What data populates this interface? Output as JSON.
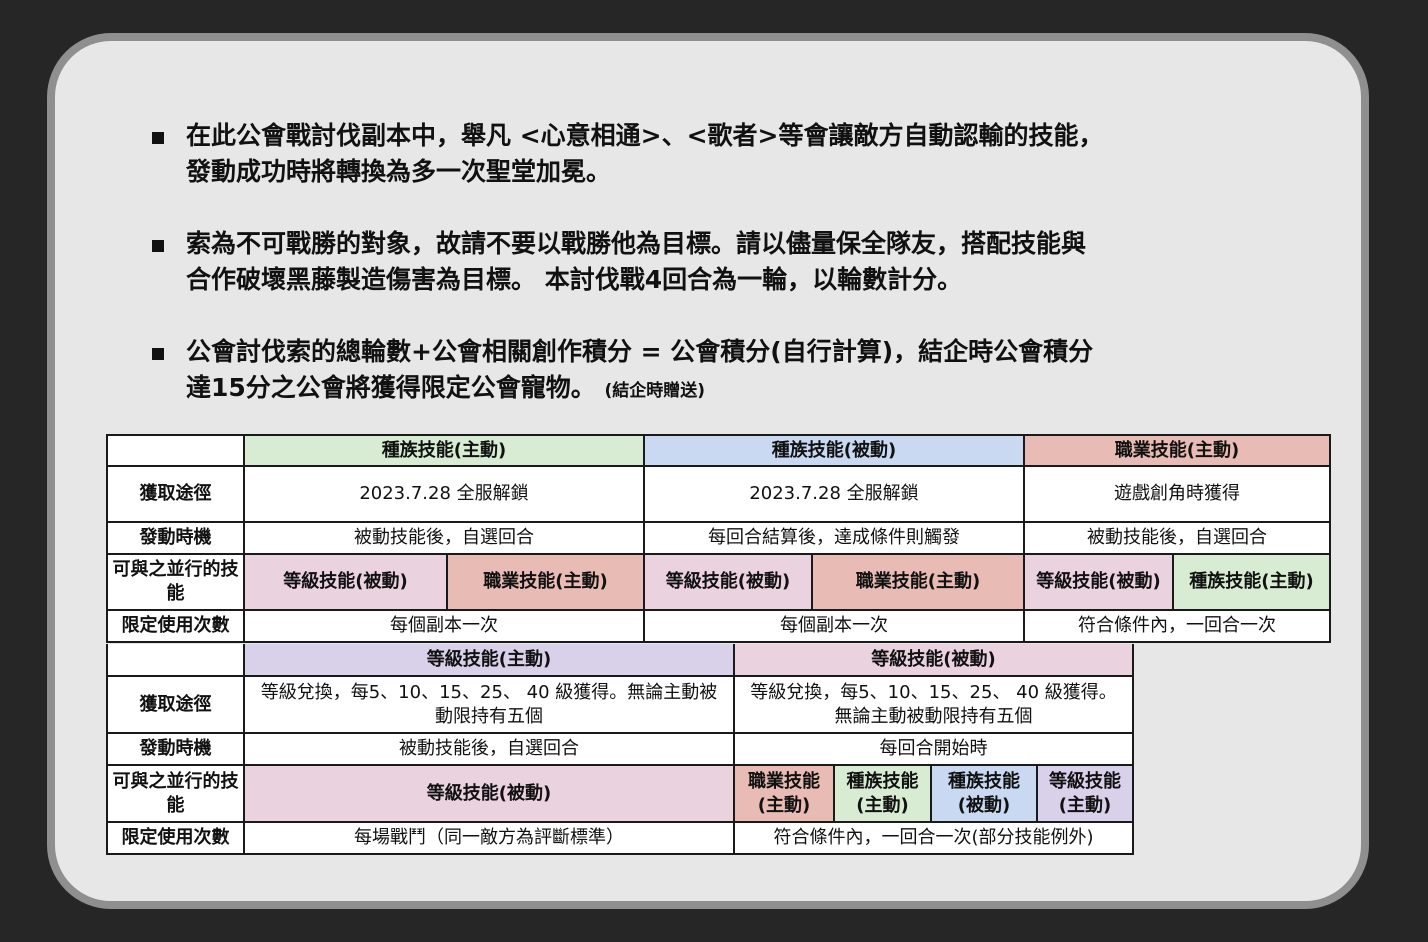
{
  "colors": {
    "race_active": "#d7ecd3",
    "race_passive": "#c9d9f2",
    "job_active": "#e8bcb4",
    "level_active": "#d9d1ea",
    "level_passive": "#ead2df",
    "panel_bg": "#e7e7e7",
    "panel_border": "#8f8f8f",
    "page_bg": "#262626"
  },
  "bullets": [
    {
      "lines": [
        "在此公會戰討伐副本中，舉凡 <心意相通>、<歌者>等會讓敵方自動認輸的技能，",
        "發動成功時將轉換為多一次聖堂加冕。"
      ]
    },
    {
      "lines": [
        "索為不可戰勝的對象，故請不要以戰勝他為目標。請以儘量保全隊友，搭配技能與",
        "合作破壞黑藤製造傷害為目標。 本討伐戰4回合為一輪，以輪數計分。"
      ]
    },
    {
      "lines": [
        "公會討伐索的總輪數+公會相關創作積分 = 公會積分(自行計算)，結企時公會積分",
        "達15分之公會將獲得限定公會寵物。"
      ],
      "note": "(結企時贈送)"
    }
  ],
  "table1": {
    "headers": [
      "種族技能(主動)",
      "種族技能(被動)",
      "職業技能(主動)"
    ],
    "row_labels": [
      "獲取途徑",
      "發動時機",
      "可與之並行的技能",
      "限定使用次數"
    ],
    "acquire": [
      "2023.7.28 全服解鎖",
      "2023.7.28 全服解鎖",
      "遊戲創角時獲得"
    ],
    "timing": [
      "被動技能後，自選回合",
      "每回合結算後，達成條件則觸發",
      "被動技能後，自選回合"
    ],
    "parallel": [
      "等級技能(被動)",
      "職業技能(主動)",
      "等級技能(被動)",
      "職業技能(主動)",
      "等級技能(被動)",
      "種族技能(主動)"
    ],
    "limit": [
      "每個副本一次",
      "每個副本一次",
      "符合條件內，一回合一次"
    ]
  },
  "table2": {
    "headers": [
      "等級技能(主動)",
      "等級技能(被動)"
    ],
    "row_labels": [
      "獲取途徑",
      "發動時機",
      "可與之並行的技能",
      "限定使用次數"
    ],
    "acquire": [
      "等級兌換，每5、10、15、25、 40 級獲得。無論主動被動限持有五個",
      "等級兌換，每5、10、15、25、 40 級獲得。無論主動被動限持有五個"
    ],
    "timing": [
      "被動技能後，自選回合",
      "每回合開始時"
    ],
    "parallel_active": "等級技能(被動)",
    "parallel_passive": [
      "職業技能(主動)",
      "種族技能(主動)",
      "種族技能(被動)",
      "等級技能(主動)"
    ],
    "limit": [
      "每場戰鬥（同一敵方為評斷標準）",
      "符合條件內，一回合一次(部分技能例外)"
    ]
  }
}
